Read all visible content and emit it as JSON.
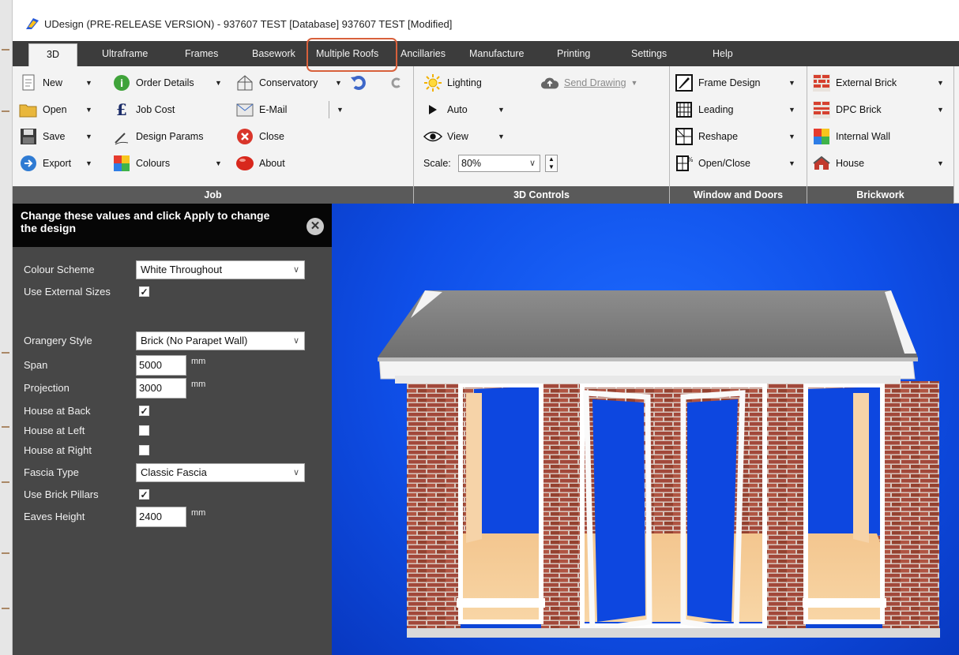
{
  "window": {
    "title": "UDesign (PRE-RELEASE VERSION) - 937607 TEST [Database] 937607 TEST [Modified]"
  },
  "tabs": [
    {
      "label": "3D"
    },
    {
      "label": "Ultraframe"
    },
    {
      "label": "Frames"
    },
    {
      "label": "Basework"
    },
    {
      "label": "Multiple Roofs"
    },
    {
      "label": "Ancillaries"
    },
    {
      "label": "Manufacture"
    },
    {
      "label": "Printing"
    },
    {
      "label": "Settings"
    },
    {
      "label": "Help"
    }
  ],
  "ribbon": {
    "job": {
      "label": "Job",
      "new": "New",
      "open": "Open",
      "save": "Save",
      "export": "Export",
      "order_details": "Order Details",
      "job_cost": "Job Cost",
      "design_params": "Design Params",
      "colours": "Colours",
      "conservatory": "Conservatory",
      "email": "E-Mail",
      "close": "Close",
      "about": "About"
    },
    "controls": {
      "label": "3D Controls",
      "lighting": "Lighting",
      "send_drawing": "Send Drawing",
      "auto": "Auto",
      "view": "View",
      "scale_label": "Scale:",
      "scale_value": "80%"
    },
    "windows": {
      "label": "Window and Doors",
      "frame_design": "Frame Design",
      "leading": "Leading",
      "reshape": "Reshape",
      "open_close": "Open/Close"
    },
    "brickwork": {
      "label": "Brickwork",
      "external_brick": "External Brick",
      "dpc_brick": "DPC Brick",
      "internal_wall": "Internal Wall",
      "house": "House"
    }
  },
  "panel": {
    "header": "Change these values and click Apply to change the design",
    "fields": {
      "colour_scheme": {
        "label": "Colour Scheme",
        "value": "White Throughout"
      },
      "use_external_sizes": {
        "label": "Use External Sizes",
        "checked": true
      },
      "orangery_style": {
        "label": "Orangery Style",
        "value": "Brick (No Parapet Wall)"
      },
      "span": {
        "label": "Span",
        "value": "5000",
        "unit": "mm"
      },
      "projection": {
        "label": "Projection",
        "value": "3000",
        "unit": "mm"
      },
      "house_at_back": {
        "label": "House at Back",
        "checked": true
      },
      "house_at_left": {
        "label": "House at Left",
        "checked": false
      },
      "house_at_right": {
        "label": "House at Right",
        "checked": false
      },
      "fascia_type": {
        "label": "Fascia Type",
        "value": "Classic Fascia"
      },
      "use_brick_pillars": {
        "label": "Use Brick Pillars",
        "checked": true
      },
      "eaves_height": {
        "label": "Eaves Height",
        "value": "2400",
        "unit": "mm"
      }
    }
  },
  "colors": {
    "tabbar": "#3c3c3c",
    "highlight": "#d8603b",
    "viewport_blue": "#1050f0",
    "brick": "#a2483a"
  }
}
